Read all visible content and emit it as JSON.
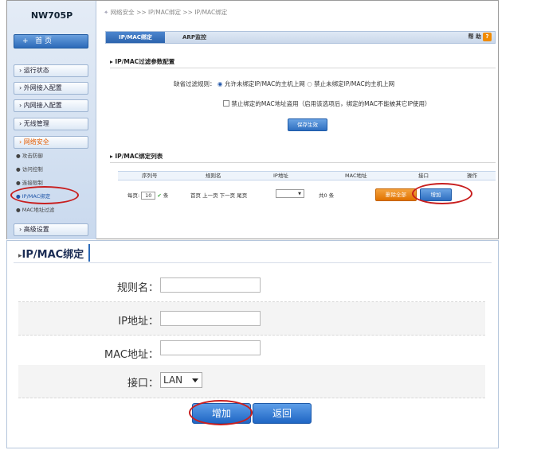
{
  "sidebar": {
    "model": "NW705P",
    "home": "首 页",
    "home_icon_char": "+",
    "nav": [
      {
        "label": "› 运行状态"
      },
      {
        "label": "› 外网接入配置"
      },
      {
        "label": "› 内网接入配置"
      },
      {
        "label": "› 无线管理"
      },
      {
        "label": "› 网络安全"
      },
      {
        "label": "› 高级设置"
      }
    ],
    "sub": [
      {
        "label": "● 攻击防御"
      },
      {
        "label": "● 访问控制"
      },
      {
        "label": "● 连接限制"
      },
      {
        "label": "● IP/MAC绑定"
      },
      {
        "label": "● MAC地址过滤"
      }
    ]
  },
  "breadcrumb": "网络安全 >> IP/MAC绑定 >> IP/MAC绑定",
  "tabs": {
    "tab1": "IP/MAC绑定",
    "tab2": "ARP监控"
  },
  "help": {
    "label": "帮 助",
    "icon": "?"
  },
  "filter": {
    "title": "IP/MAC过滤参数配置",
    "rule_label": "缺省过滤规则：",
    "opt_allow": "允许未绑定IP/MAC的主机上网",
    "opt_deny": "禁止未绑定IP/MAC的主机上网",
    "checkbox_label": "禁止绑定的MAC地址盗用（启用该选项后，绑定的MAC不能被其它IP使用）",
    "save": "保存生效"
  },
  "list": {
    "title": "IP/MAC绑定列表",
    "columns": [
      "序列号",
      "规则名",
      "IP地址",
      "MAC地址",
      "接口",
      "操作"
    ],
    "per_page_label": "每页:",
    "per_page_value": "10",
    "per_page_unit": "条",
    "pager": "首页 上一页 下一页 尾页",
    "total": "共0 条",
    "delete_all": "删除全部",
    "add": "增加"
  },
  "form": {
    "title": "IP/MAC绑定",
    "rule_name_label": "规则名：",
    "ip_label": "IP地址：",
    "mac_label": "MAC地址：",
    "iface_label": "接口：",
    "iface_value": "LAN",
    "add": "增加",
    "back": "返回"
  },
  "colors": {
    "accent": "#2c6ab8",
    "highlight": "#c81e1e",
    "orange": "#e07200"
  }
}
